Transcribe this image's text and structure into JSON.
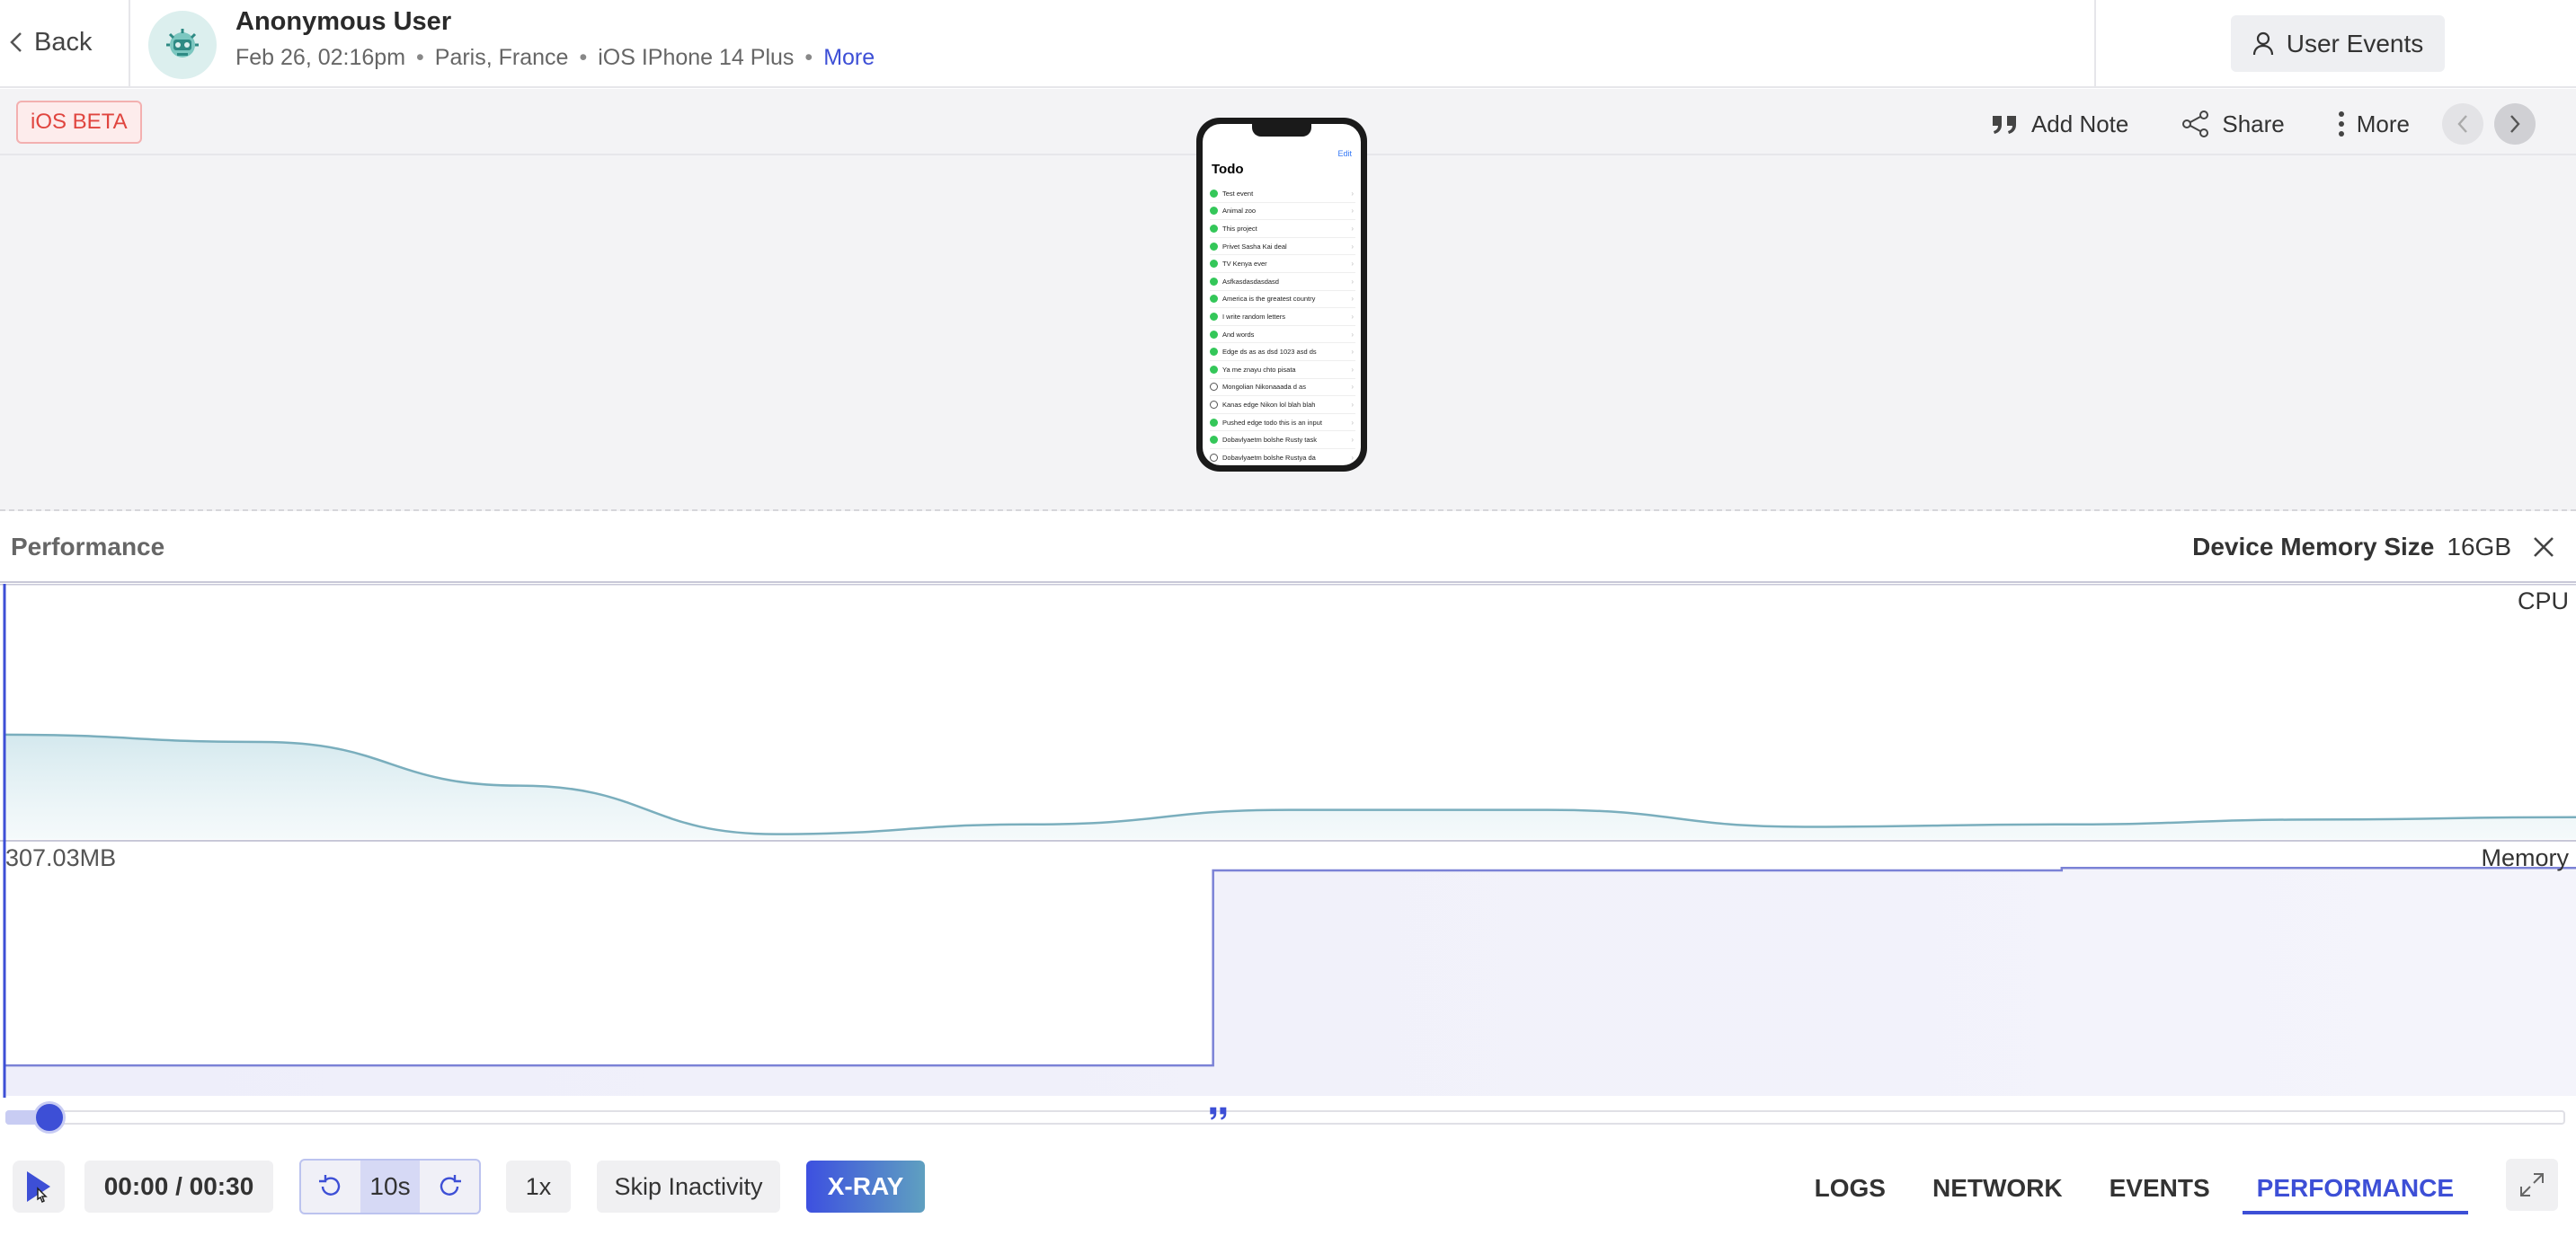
{
  "header": {
    "back_label": "Back",
    "user_name": "Anonymous User",
    "meta": {
      "datetime": "Feb 26, 02:16pm",
      "location": "Paris, France",
      "device": "iOS IPhone 14 Plus",
      "more_label": "More"
    },
    "user_events_label": "User Events"
  },
  "player": {
    "platform_badge": "iOS BETA",
    "actions": {
      "add_note": "Add Note",
      "share": "Share",
      "more": "More"
    },
    "phone": {
      "edit_label": "Edit",
      "title": "Todo",
      "todos": [
        {
          "text": "Test event",
          "done": true
        },
        {
          "text": "Animal zoo",
          "done": true
        },
        {
          "text": "This project",
          "done": true
        },
        {
          "text": "Privet Sasha Kai deal",
          "done": true
        },
        {
          "text": "TV Kenya ever",
          "done": true
        },
        {
          "text": "Asfkasdasdasdasd",
          "done": true
        },
        {
          "text": "America is the greatest country",
          "done": true
        },
        {
          "text": "I write random letters",
          "done": true
        },
        {
          "text": "And words",
          "done": true
        },
        {
          "text": "Edge ds as as dsd 1023 asd ds",
          "done": true
        },
        {
          "text": "Ya me znayu chto pisata",
          "done": true
        },
        {
          "text": "Mongolian Nikonaaada d as",
          "done": false
        },
        {
          "text": "Kanas edge Nikon lol blah blah",
          "done": false
        },
        {
          "text": "Pushed edge todo this is an input",
          "done": true
        },
        {
          "text": "Dobavlyaetm bolshe Rusty task",
          "done": true
        },
        {
          "text": "Dobavlyaetm bolshe Rustya da",
          "done": false
        }
      ]
    }
  },
  "performance": {
    "title": "Performance",
    "device_memory_label": "Device Memory Size",
    "device_memory_value": "16GB",
    "cpu_label": "CPU",
    "memory_label": "Memory",
    "memory_value": "307.03MB"
  },
  "chart_data": [
    {
      "type": "area",
      "title": "CPU",
      "x": [
        0,
        3,
        6,
        9,
        12,
        15,
        18,
        21,
        24,
        27,
        30
      ],
      "values": [
        0.43,
        0.4,
        0.22,
        0.02,
        0.06,
        0.12,
        0.12,
        0.05,
        0.06,
        0.08,
        0.09
      ],
      "ylim": [
        0,
        1
      ]
    },
    {
      "type": "area",
      "title": "Memory",
      "x": [
        0,
        14.1,
        14.1,
        24,
        24,
        30
      ],
      "values": [
        0.12,
        0.12,
        0.89,
        0.89,
        0.9,
        0.9
      ],
      "ylim": [
        0,
        1
      ]
    }
  ],
  "controls": {
    "time": "00:00 / 00:30",
    "skip_amount": "10s",
    "speed": "1x",
    "skip_inactivity": "Skip Inactivity",
    "xray": "X-RAY",
    "progress": 0
  },
  "tabs": [
    {
      "label": "LOGS",
      "active": false
    },
    {
      "label": "NETWORK",
      "active": false
    },
    {
      "label": "EVENTS",
      "active": false
    },
    {
      "label": "PERFORMANCE",
      "active": true
    }
  ]
}
